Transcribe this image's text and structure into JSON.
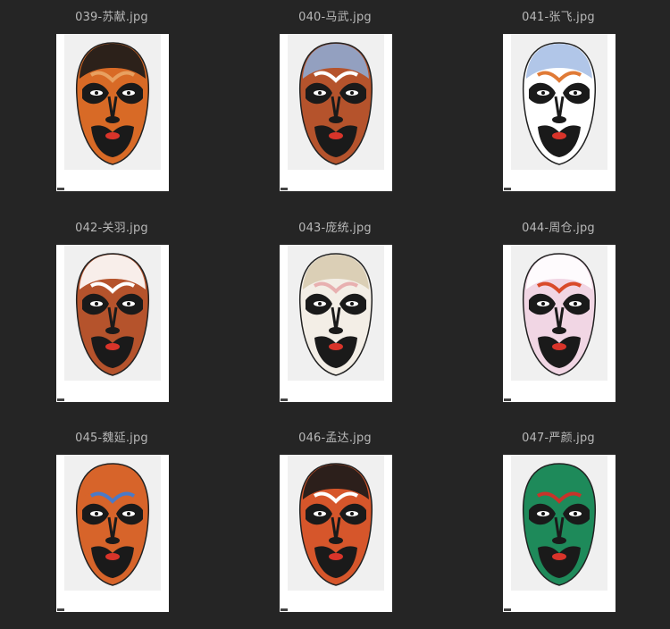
{
  "files": [
    {
      "name": "039-苏献.jpg",
      "face": "#d86a26",
      "paint": "#1a1a1a",
      "accent": "#e8a060",
      "top": "#1a1a1a"
    },
    {
      "name": "040-马武.jpg",
      "face": "#b5532c",
      "paint": "#1a1a1a",
      "accent": "#ffffff",
      "top": "#8fa9d0"
    },
    {
      "name": "041-张飞.jpg",
      "face": "#ffffff",
      "paint": "#1a1a1a",
      "accent": "#e07a36",
      "top": "#a9c0e6"
    },
    {
      "name": "042-关羽.jpg",
      "face": "#b5532c",
      "paint": "#1a1a1a",
      "accent": "#ffffff",
      "top": "#ffffff"
    },
    {
      "name": "043-庞统.jpg",
      "face": "#f3eee6",
      "paint": "#1a1a1a",
      "accent": "#e8b0b0",
      "top": "#d8cbb0"
    },
    {
      "name": "044-周仓.jpg",
      "face": "#f1d6e4",
      "paint": "#1a1a1a",
      "accent": "#d94a2a",
      "top": "#ffffff"
    },
    {
      "name": "045-魏延.jpg",
      "face": "#d7642a",
      "paint": "#1a1a1a",
      "accent": "#4a7ac8",
      "top": "#d7642a"
    },
    {
      "name": "046-孟达.jpg",
      "face": "#d6562b",
      "paint": "#1a1a1a",
      "accent": "#ffffff",
      "top": "#1a1a1a"
    },
    {
      "name": "047-严颜.jpg",
      "face": "#1e8a5a",
      "paint": "#1a1a1a",
      "accent": "#c8332a",
      "top": "#1e8a5a"
    }
  ]
}
